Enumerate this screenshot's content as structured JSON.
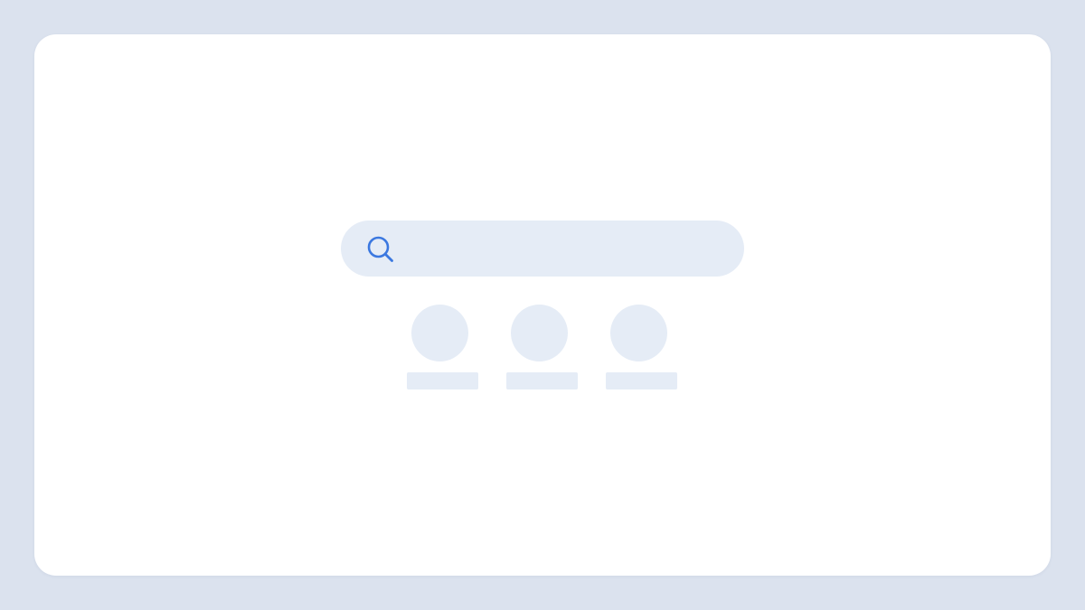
{
  "search": {
    "placeholder": "",
    "value": "",
    "icon": "search-icon"
  },
  "colors": {
    "background": "#dbe2ee",
    "card": "#ffffff",
    "skeleton": "#e5ecf6",
    "accent": "#3b78e0"
  },
  "shortcuts": [
    {
      "label": ""
    },
    {
      "label": ""
    },
    {
      "label": ""
    }
  ]
}
